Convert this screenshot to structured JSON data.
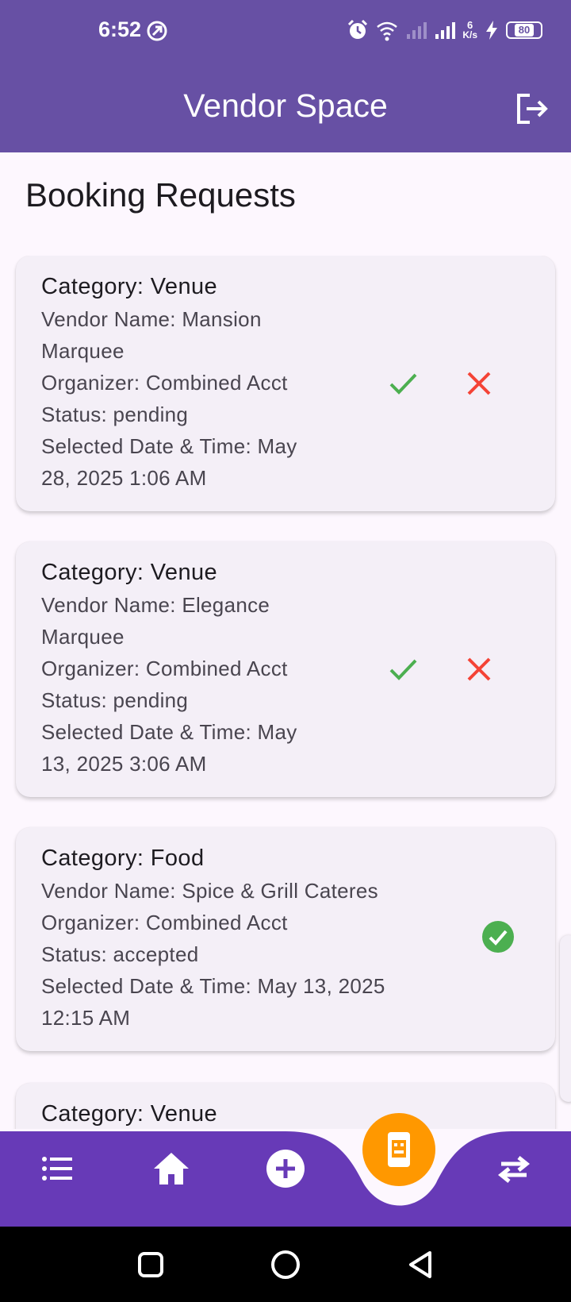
{
  "status_bar": {
    "time": "6:52",
    "net_speed_value": "6",
    "net_speed_unit": "K/s",
    "battery": "80",
    "icons": [
      "vpn-icon",
      "alarm-icon",
      "wifi-icon",
      "signal-icon",
      "signal-icon",
      "charging-icon",
      "battery-icon"
    ]
  },
  "app_bar": {
    "title": "Vendor Space",
    "action_icon": "logout-icon"
  },
  "page": {
    "title": "Booking Requests"
  },
  "requests": [
    {
      "category": "Category: Venue",
      "vendor_1": "Vendor Name: Mansion",
      "vendor_2": "Marquee",
      "organizer": "Organizer: Combined Acct",
      "status": "Status: pending",
      "date_1": "Selected Date & Time: May",
      "date_2": "28, 2025 1:06 AM"
    },
    {
      "category": "Category: Venue",
      "vendor_1": "Vendor Name: Elegance",
      "vendor_2": "Marquee",
      "organizer": "Organizer: Combined Acct",
      "status": "Status: pending",
      "date_1": "Selected Date & Time: May",
      "date_2": "13, 2025 3:06 AM"
    },
    {
      "category": "Category: Food",
      "vendor_1": "Vendor Name: Spice & Grill Cateres",
      "organizer": "Organizer: Combined Acct",
      "status": "Status: accepted",
      "date_1": "Selected Date & Time: May 13, 2025",
      "date_2": "12:15 AM"
    },
    {
      "category": "Category: Venue"
    }
  ],
  "bottom_nav": {
    "items": [
      "list-icon",
      "home-icon",
      "add-circle-icon",
      "booking-icon",
      "swap-icon"
    ],
    "active": "booking-icon"
  },
  "colors": {
    "primary": "#6750a4",
    "nav_bar": "#673ab7",
    "fab": "#ff9800",
    "accept": "#4caf50",
    "reject": "#f44336",
    "card": "#f4eff7",
    "background": "#fdf7fe"
  }
}
